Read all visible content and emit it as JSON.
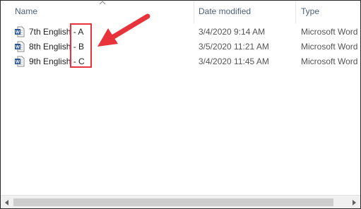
{
  "columns": {
    "name": "Name",
    "date_modified": "Date modified",
    "type": "Type"
  },
  "files": [
    {
      "name": "7th English - A",
      "date": "3/4/2020 9:14 AM",
      "type": "Microsoft Word"
    },
    {
      "name": "8th English - B",
      "date": "3/5/2020 11:21 AM",
      "type": "Microsoft Word"
    },
    {
      "name": "9th English - C",
      "date": "3/4/2020 11:45 AM",
      "type": "Microsoft Word"
    }
  ],
  "icons": {
    "file": "word-document-icon",
    "sort": "chevron-up-icon",
    "annotation": "red-arrow"
  },
  "colors": {
    "header_text": "#4c607a",
    "annotation": "#e8333c",
    "word_blue": "#2b579a"
  }
}
